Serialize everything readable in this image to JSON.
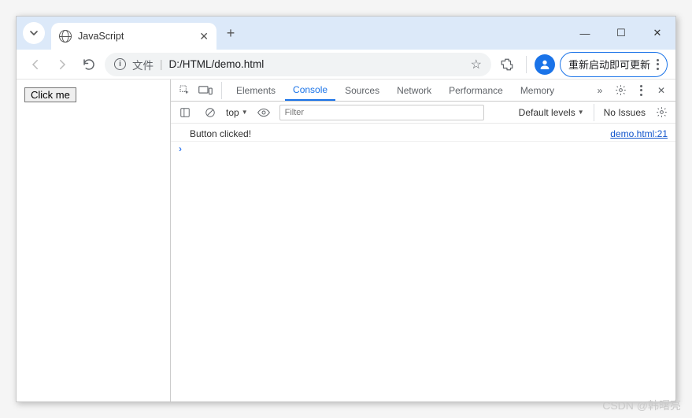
{
  "titlebar": {
    "tab_title": "JavaScript",
    "win_min": "—",
    "win_max": "☐",
    "win_close": "✕"
  },
  "addrbar": {
    "file_label": "文件",
    "url": "D:/HTML/demo.html",
    "update_label": "重新启动即可更新"
  },
  "page": {
    "button_label": "Click me"
  },
  "devtools": {
    "tabs": {
      "elements": "Elements",
      "console": "Console",
      "sources": "Sources",
      "network": "Network",
      "performance": "Performance",
      "memory": "Memory"
    },
    "toolbar": {
      "context": "top",
      "filter_placeholder": "Filter",
      "levels": "Default levels",
      "issues": "No Issues"
    },
    "log": {
      "msg": "Button clicked!",
      "src": "demo.html:21"
    },
    "prompt": "›"
  },
  "watermark": "CSDN @韩曙亮"
}
